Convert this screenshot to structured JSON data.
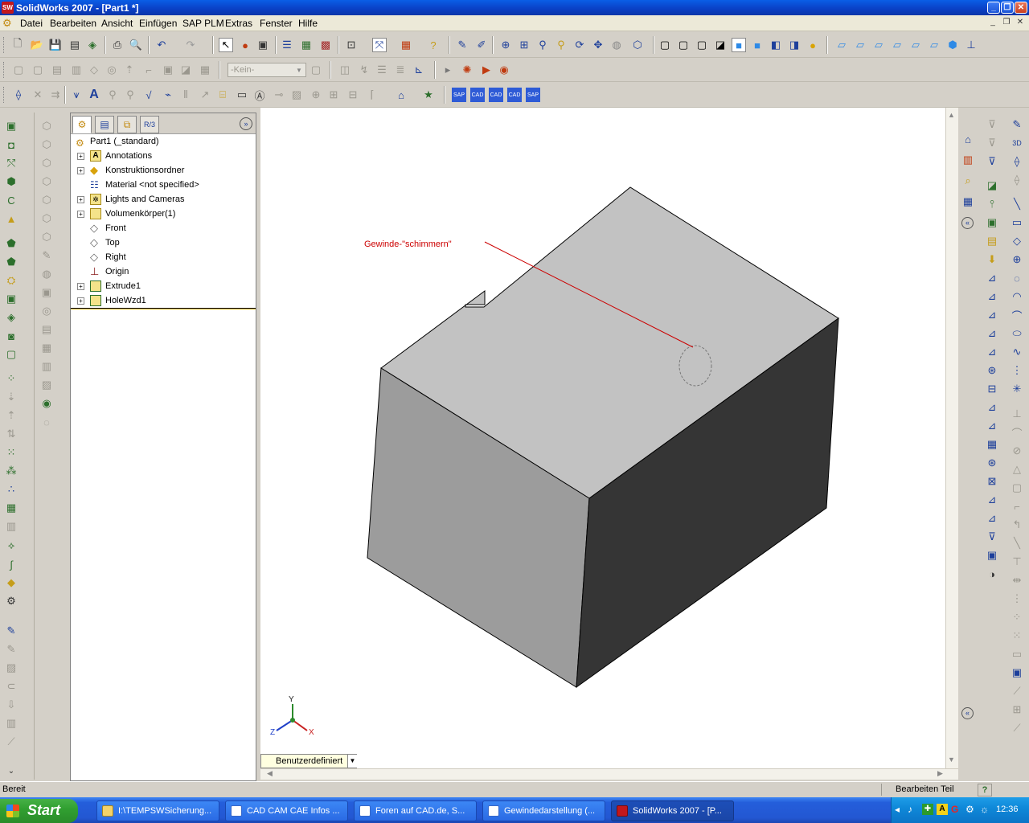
{
  "window": {
    "title": "SolidWorks 2007 - [Part1 *]",
    "app_icon_text": "SW"
  },
  "menu": {
    "items": [
      "Datei",
      "Bearbeiten",
      "Ansicht",
      "Einfügen",
      "SAP PLM",
      "Extras",
      "Fenster",
      "Hilfe"
    ]
  },
  "toolbar": {
    "layer_select_value": "-Kein-"
  },
  "feature_tree": {
    "root": "Part1  (_standard)",
    "nodes": [
      {
        "label": "Annotations",
        "expandable": true,
        "icon": "annotations-icon"
      },
      {
        "label": "Konstruktionsordner",
        "expandable": true,
        "icon": "design-binder-icon"
      },
      {
        "label": "Material <not specified>",
        "expandable": false,
        "icon": "material-icon"
      },
      {
        "label": "Lights and Cameras",
        "expandable": true,
        "icon": "lights-icon"
      },
      {
        "label": "Volumenkörper(1)",
        "expandable": true,
        "icon": "solid-bodies-icon"
      },
      {
        "label": "Front",
        "expandable": false,
        "icon": "plane-icon"
      },
      {
        "label": "Top",
        "expandable": false,
        "icon": "plane-icon"
      },
      {
        "label": "Right",
        "expandable": false,
        "icon": "plane-icon"
      },
      {
        "label": "Origin",
        "expandable": false,
        "icon": "origin-icon"
      },
      {
        "label": "Extrude1",
        "expandable": true,
        "icon": "extrude-icon"
      },
      {
        "label": "HoleWzd1",
        "expandable": true,
        "icon": "hole-wizard-icon"
      }
    ]
  },
  "graphics": {
    "annotation_text": "Gewinde-\"schimmern\"",
    "annotation_color": "#cc0000",
    "axis_labels": {
      "x": "X",
      "y": "Y",
      "z": "Z"
    },
    "view_tab": "Benutzerdefiniert"
  },
  "status": {
    "left": "Bereit",
    "right": "Bearbeiten Teil"
  },
  "taskbar": {
    "start": "Start",
    "tasks": [
      {
        "label": "I:\\TEMPSWSicherung..."
      },
      {
        "label": "CAD CAM CAE Infos ..."
      },
      {
        "label": "Foren auf CAD.de, S..."
      },
      {
        "label": "Gewindedarstellung (..."
      },
      {
        "label": "SolidWorks 2007 - [P..."
      }
    ],
    "clock": "12:36"
  },
  "colors": {
    "titlebar": "#0a4fd8",
    "top_face": "#c0c0c0",
    "left_face": "#9a9a9a",
    "right_face": "#333333"
  }
}
